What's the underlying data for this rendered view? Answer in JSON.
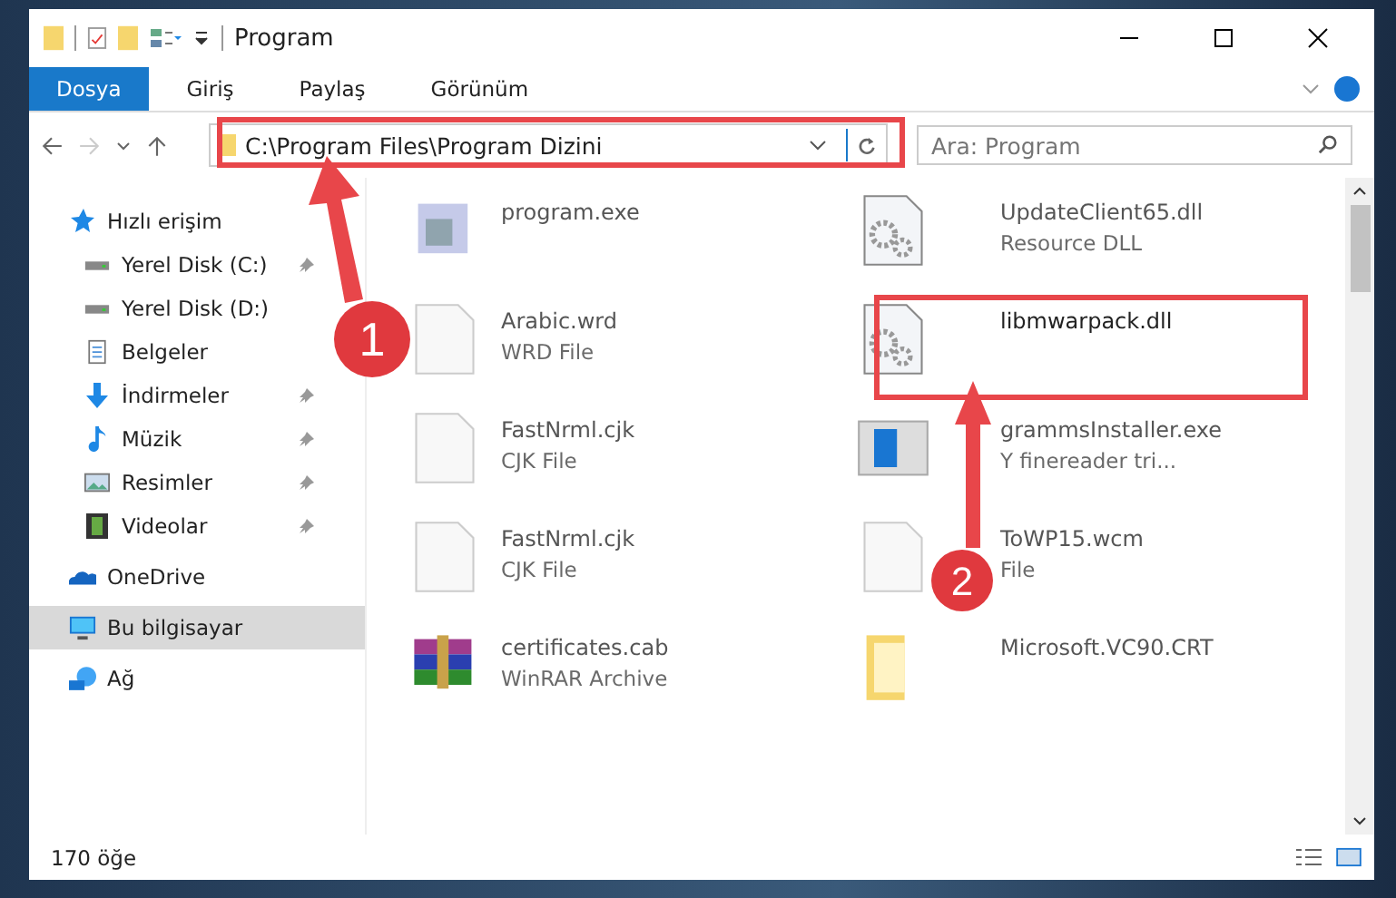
{
  "window": {
    "title": "Program"
  },
  "ribbon_tabs": [
    {
      "label": "Dosya",
      "selected": true
    },
    {
      "label": "Giriş",
      "selected": false
    },
    {
      "label": "Paylaş",
      "selected": false
    },
    {
      "label": "Görünüm",
      "selected": false
    }
  ],
  "address_bar": {
    "path": "C:\\Program Files\\Program Dizini"
  },
  "search": {
    "placeholder": "Ara: Program"
  },
  "sidebar": {
    "items": [
      {
        "label": "Hızlı erişim",
        "kind": "star",
        "selected": false,
        "children": [
          {
            "label": "Yerel Disk (C:)",
            "kind": "drive",
            "pinned": true,
            "selected": false
          },
          {
            "label": "Yerel Disk (D:)",
            "kind": "drive",
            "pinned": false,
            "selected": false
          },
          {
            "label": "Belgeler",
            "kind": "document",
            "pinned": false,
            "selected": false
          },
          {
            "label": "İndirmeler",
            "kind": "download",
            "pinned": true,
            "selected": false
          },
          {
            "label": "Müzik",
            "kind": "music",
            "pinned": true,
            "selected": false
          },
          {
            "label": "Resimler",
            "kind": "picture",
            "pinned": true,
            "selected": false
          },
          {
            "label": "Videolar",
            "kind": "film",
            "pinned": true,
            "selected": false
          }
        ]
      },
      {
        "label": "OneDrive",
        "kind": "cloud",
        "selected": false
      },
      {
        "label": "Bu bilgisayar",
        "kind": "monitor",
        "selected": true
      },
      {
        "label": "Ağ",
        "kind": "network",
        "selected": false
      }
    ]
  },
  "files": [
    {
      "name": "program.exe",
      "kind": "exe"
    },
    {
      "name": "UpdateClient65.dll",
      "type": "Resource DLL",
      "kind": "dll"
    },
    {
      "name": "Arabic.wrd",
      "type": "WRD File",
      "kind": "blank"
    },
    {
      "name": "libmwarpack.dll",
      "kind": "dll"
    },
    {
      "name": "FastNrml.cjk",
      "type": "CJK File",
      "kind": "blank"
    },
    {
      "name": "grammsInstaller.exe",
      "type": "Y finereader tri...",
      "kind": "installer"
    },
    {
      "name": "FastNrml.cjk",
      "type": "CJK File",
      "kind": "blank"
    },
    {
      "name": "ToWP15.wcm",
      "type": "File",
      "kind": "blank"
    },
    {
      "name": "certificates.cab",
      "type": "WinRAR Archive",
      "kind": "archive"
    },
    {
      "name": "Microsoft.VC90.CRT",
      "kind": "folder"
    }
  ],
  "annotations": [
    {
      "number": "1"
    },
    {
      "number": "2"
    }
  ],
  "status_bar": {
    "count": "170 öğe"
  }
}
